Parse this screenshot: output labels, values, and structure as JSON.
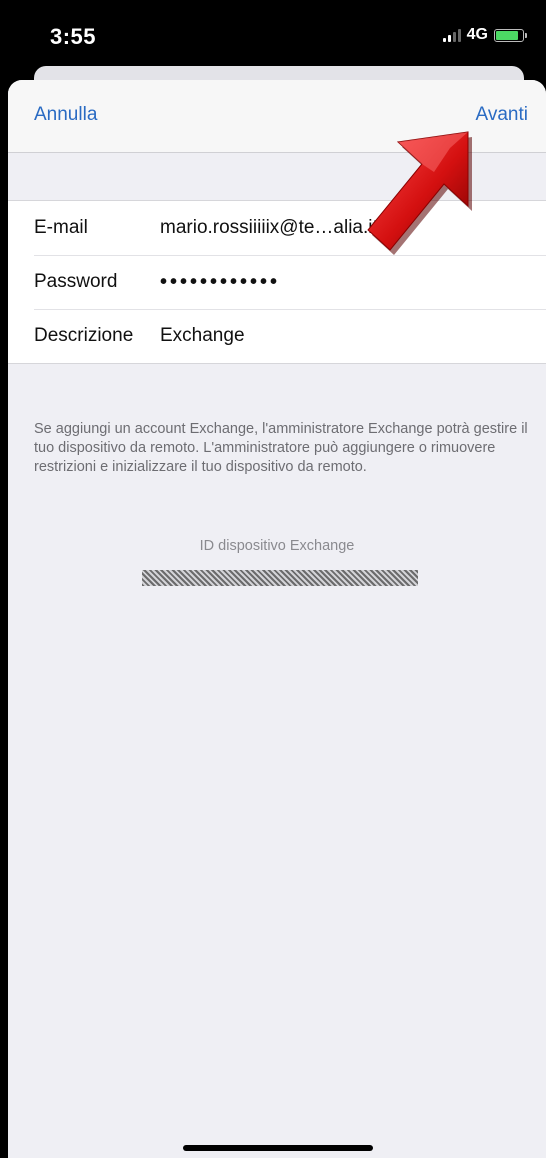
{
  "status_bar": {
    "time": "3:55",
    "network": "4G",
    "signal_bars": 4,
    "signal_bars_active": 2,
    "battery_color": "#4cd964"
  },
  "nav": {
    "cancel_label": "Annulla",
    "next_label": "Avanti",
    "accent_color": "#2a6bc3"
  },
  "form": {
    "email_label": "E-mail",
    "email_value": "mario.rossiiiiix@te…alia.it",
    "password_label": "Password",
    "password_value": "••••••••••••",
    "description_label": "Descrizione",
    "description_value": "Exchange"
  },
  "info": {
    "note": "Se aggiungi un account Exchange, l'amministratore Exchange potrà gestire il tuo dispositivo da remoto. L'amministratore può aggiungere o rimuovere restrizioni e inizializzare il tuo dispositivo da remoto.",
    "device_id_caption": "ID dispositivo Exchange"
  },
  "icons": {
    "annotation": "red-arrow-icon",
    "signal": "cellular-signal-icon",
    "battery": "battery-icon"
  }
}
